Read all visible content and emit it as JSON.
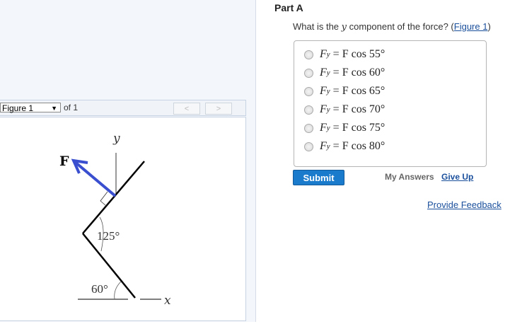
{
  "figure_toolbar": {
    "selected": "Figure 1",
    "of_label": "of 1",
    "prev": "<",
    "next": ">"
  },
  "figure": {
    "force_label": "F",
    "y_label": "y",
    "x_label": "x",
    "angle_125": "125°",
    "angle_60": "60°",
    "force_color": "#3a4fcf"
  },
  "part": {
    "title": "Part A",
    "question_pre": "What is the ",
    "question_var": "y",
    "question_post": " component of the force? (",
    "figure_link": "Figure 1",
    "question_end": ")"
  },
  "options": [
    {
      "lhs": "F",
      "sub": "y",
      "rhs": "= F cos 55°"
    },
    {
      "lhs": "F",
      "sub": "y",
      "rhs": "= F cos 60°"
    },
    {
      "lhs": "F",
      "sub": "y",
      "rhs": "= F cos 65°"
    },
    {
      "lhs": "F",
      "sub": "y",
      "rhs": "= F cos 70°"
    },
    {
      "lhs": "F",
      "sub": "y",
      "rhs": "= F cos 75°"
    },
    {
      "lhs": "F",
      "sub": "y",
      "rhs": "= F cos 80°"
    }
  ],
  "actions": {
    "submit": "Submit",
    "my_answers": "My Answers",
    "give_up": "Give Up",
    "provide_feedback": "Provide Feedback"
  }
}
